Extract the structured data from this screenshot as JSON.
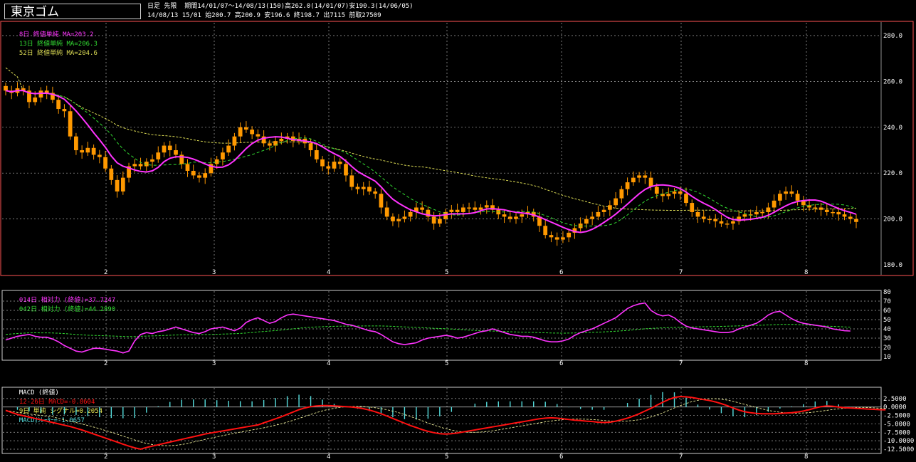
{
  "header": {
    "title": "東京ゴム",
    "line1": "日足 先限  期間14/01/07～14/08/13(150)高262.0(14/01/07)安190.3(14/06/05)",
    "line2": "14/08/13 15/01 始200.7 高200.9 安196.6 終198.7 出7115 前取27509"
  },
  "colors": {
    "candle": "#ff9900",
    "ma8": "#ff33ff",
    "ma13": "#33dd33",
    "ma52": "#dddd55",
    "rsi14": "#ff33ff",
    "rsi42": "#33dd33",
    "macd": "#ff1111",
    "signal": "#eeee99",
    "osc": "#55dddd",
    "frame_main": "#ff5555",
    "frame": "#cccccc"
  },
  "price_panel": {
    "legend": [
      {
        "text": "8日 終値単純 MA=203.2",
        "color": "#ff33ff"
      },
      {
        "text": "13日 終値単純 MA=206.3",
        "color": "#33dd33"
      },
      {
        "text": "52日 終値単純 MA=204.6",
        "color": "#dddd55"
      }
    ],
    "y_ticks": [
      "280.0",
      "260.0",
      "240.0",
      "220.0",
      "200.0",
      "180.0"
    ]
  },
  "rsi_panel": {
    "legend": [
      {
        "text": "014日 相対力 (終値)=37.7247",
        "color": "#ff33ff"
      },
      {
        "text": "042日 相対力 (終値)=44.2890",
        "color": "#33dd33"
      }
    ],
    "y_ticks": [
      "80",
      "70",
      "60",
      "50",
      "40",
      "30",
      "20",
      "10"
    ]
  },
  "macd_panel": {
    "legend": [
      {
        "text": "MACD (終値)",
        "color": "#ffffff"
      },
      {
        "text": "12-26日 MACD=-0.8604",
        "color": "#ff1111"
      },
      {
        "text": "9日 単純 シグナル=0.2054",
        "color": "#eeee55"
      },
      {
        "text": "MACDｵｼﾚｰﾀｰ=-1.0657",
        "color": "#55dddd"
      }
    ],
    "y_ticks": [
      "2.5000",
      "0.0000",
      "-2.5000",
      "-5.0000",
      "-7.5000",
      "-10.0000",
      "-12.5000"
    ]
  },
  "x_ticks": [
    "2",
    "3",
    "4",
    "5",
    "6",
    "7",
    "8"
  ],
  "chart_data": [
    {
      "type": "candlestick",
      "title": "東京ゴム 日足 先限",
      "ylim": [
        180,
        285
      ],
      "x_month_labels": [
        "2",
        "3",
        "4",
        "5",
        "6",
        "7",
        "8"
      ],
      "close": [
        256,
        255,
        257,
        256,
        251,
        253,
        256,
        255,
        252,
        248,
        247,
        236,
        230,
        229,
        231,
        228,
        227,
        222,
        217,
        212,
        218,
        223,
        224,
        223,
        225,
        226,
        229,
        232,
        230,
        228,
        224,
        221,
        219,
        218,
        220,
        224,
        226,
        229,
        232,
        236,
        240,
        239,
        237,
        236,
        233,
        232,
        234,
        235,
        236,
        234,
        235,
        233,
        230,
        226,
        223,
        222,
        225,
        224,
        219,
        214,
        213,
        214,
        212,
        211,
        205,
        201,
        199,
        200,
        201,
        203,
        205,
        204,
        201,
        198,
        200,
        203,
        204,
        203,
        205,
        205,
        204,
        205,
        206,
        204,
        202,
        201,
        200,
        201,
        202,
        203,
        201,
        197,
        193,
        192,
        191,
        192,
        194,
        196,
        198,
        200,
        201,
        203,
        204,
        206,
        209,
        213,
        216,
        218,
        219,
        218,
        214,
        211,
        210,
        211,
        212,
        211,
        207,
        203,
        201,
        200,
        200,
        199,
        198,
        198,
        199,
        201,
        202,
        202,
        203,
        203,
        205,
        208,
        211,
        212,
        211,
        208,
        206,
        205,
        205,
        204,
        203,
        203,
        202,
        201,
        200,
        198.7
      ],
      "series": [
        {
          "name": "8日 終値単純 MA",
          "last": 203.2
        },
        {
          "name": "13日 終値単純 MA",
          "last": 206.3
        },
        {
          "name": "52日 終値単純 MA",
          "last": 204.6
        }
      ]
    },
    {
      "type": "line",
      "title": "相対力 (終値)",
      "ylim": [
        10,
        80
      ],
      "series": [
        {
          "name": "014日 相対力 (終値)",
          "values": [
            28,
            30,
            32,
            33,
            34,
            32,
            31,
            31,
            29,
            26,
            22,
            19,
            16,
            15,
            17,
            19,
            19,
            18,
            17,
            16,
            14,
            16,
            27,
            34,
            36,
            35,
            37,
            38,
            40,
            42,
            40,
            38,
            36,
            35,
            37,
            40,
            41,
            42,
            40,
            38,
            41,
            47,
            50,
            52,
            49,
            46,
            48,
            52,
            55,
            56,
            55,
            54,
            53,
            52,
            51,
            50,
            49,
            47,
            45,
            44,
            42,
            40,
            38,
            37,
            34,
            30,
            26,
            24,
            23,
            24,
            25,
            28,
            30,
            31,
            32,
            33,
            32,
            30,
            31,
            33,
            35,
            37,
            38,
            40,
            38,
            36,
            34,
            33,
            32,
            32,
            31,
            29,
            27,
            26,
            26,
            27,
            29,
            33,
            36,
            38,
            40,
            43,
            46,
            49,
            52,
            57,
            62,
            65,
            67,
            68,
            60,
            56,
            54,
            55,
            52,
            47,
            43,
            41,
            40,
            39,
            38,
            37,
            36,
            36,
            37,
            40,
            42,
            44,
            46,
            50,
            55,
            58,
            59,
            55,
            51,
            48,
            46,
            45,
            44,
            43,
            42,
            40,
            39,
            38,
            37.7247
          ]
        },
        {
          "name": "042日 相対力 (終値)",
          "last": 44.289
        }
      ]
    },
    {
      "type": "line",
      "title": "MACD (終値)",
      "ylim": [
        -12.5,
        5
      ],
      "series": [
        {
          "name": "12-26日 MACD",
          "values": [
            -1,
            -1.6,
            -2.2,
            -2.6,
            -3,
            -3.4,
            -3.8,
            -4.2,
            -4.6,
            -5,
            -5.4,
            -5.8,
            -6.3,
            -6.8,
            -7.4,
            -8,
            -8.6,
            -9.2,
            -9.8,
            -10.4,
            -11,
            -11.6,
            -12.1,
            -12.5,
            -12,
            -11.6,
            -11.2,
            -10.8,
            -10.4,
            -10,
            -9.6,
            -9.2,
            -8.8,
            -8.4,
            -8,
            -7.7,
            -7.4,
            -7.1,
            -6.8,
            -6.5,
            -6.2,
            -5.9,
            -5.6,
            -5.3,
            -4.7,
            -4.1,
            -3.5,
            -2.9,
            -2.2,
            -1.5,
            -0.8,
            -0.3,
            0.1,
            0.3,
            0.4,
            0.4,
            0.3,
            0.2,
            0.1,
            0,
            -0.2,
            -0.5,
            -0.9,
            -1.4,
            -2,
            -2.7,
            -3.4,
            -4.1,
            -4.8,
            -5.5,
            -6.1,
            -6.7,
            -7.2,
            -7.6,
            -7.9,
            -8,
            -7.9,
            -7.7,
            -7.4,
            -7.1,
            -6.8,
            -6.5,
            -6.2,
            -5.9,
            -5.6,
            -5.3,
            -5,
            -4.7,
            -4.4,
            -4.1,
            -3.8,
            -3.5,
            -3.3,
            -3.2,
            -3.3,
            -3.5,
            -3.7,
            -3.9,
            -4,
            -4.2,
            -4.3,
            -4.5,
            -4.6,
            -4.5,
            -4.2,
            -3.8,
            -3.3,
            -2.7,
            -2,
            -1.2,
            -0.4,
            0.5,
            1.4,
            2.2,
            2.8,
            3.1,
            3,
            2.8,
            2.5,
            2.2,
            1.9,
            1.5,
            1,
            0.4,
            -0.3,
            -0.9,
            -1.4,
            -1.7,
            -1.9,
            -2,
            -2,
            -2,
            -1.9,
            -1.8,
            -1.7,
            -1.5,
            -1.2,
            -0.8,
            -0.3,
            0.1,
            0.3,
            0.2,
            0,
            -0.2,
            -0.3,
            -0.4,
            -0.5,
            -0.6,
            -0.7,
            -0.8,
            -0.8604
          ]
        },
        {
          "name": "9日 単純 シグナル",
          "last": 0.2054
        },
        {
          "name": "MACDｵｼﾚｰﾀｰ",
          "last": -1.0657
        }
      ]
    }
  ]
}
